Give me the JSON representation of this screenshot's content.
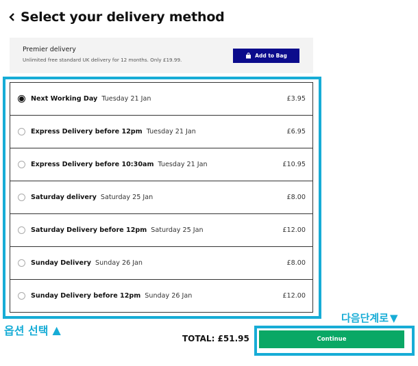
{
  "header": {
    "back_icon": "chevron-left-icon",
    "title": "Select your delivery method"
  },
  "premier": {
    "title": "Premier delivery",
    "description": "Unlimited free standard UK delivery for 12 months. Only £19.99.",
    "button_label": "Add to Bag",
    "button_icon": "shopping-bag-icon",
    "button_color": "#0b0b8c"
  },
  "options": [
    {
      "name": "Next Working Day",
      "date": "Tuesday 21 Jan",
      "price": "£3.95",
      "selected": true
    },
    {
      "name": "Express Delivery before 12pm",
      "date": "Tuesday 21 Jan",
      "price": "£6.95",
      "selected": false
    },
    {
      "name": "Express Delivery before 10:30am",
      "date": "Tuesday 21 Jan",
      "price": "£10.95",
      "selected": false
    },
    {
      "name": "Saturday delivery",
      "date": "Saturday 25 Jan",
      "price": "£8.00",
      "selected": false
    },
    {
      "name": "Saturday Delivery before 12pm",
      "date": "Saturday 25 Jan",
      "price": "£12.00",
      "selected": false
    },
    {
      "name": "Sunday Delivery",
      "date": "Sunday 26 Jan",
      "price": "£8.00",
      "selected": false
    },
    {
      "name": "Sunday Delivery before 12pm",
      "date": "Sunday 26 Jan",
      "price": "£12.00",
      "selected": false
    }
  ],
  "annotations": {
    "select_option": "옵션 선택",
    "next_step": "다음단계로",
    "color": "#17acd6"
  },
  "footer": {
    "total": "TOTAL: £51.95",
    "continue_label": "Continue",
    "continue_color": "#0aa865"
  }
}
